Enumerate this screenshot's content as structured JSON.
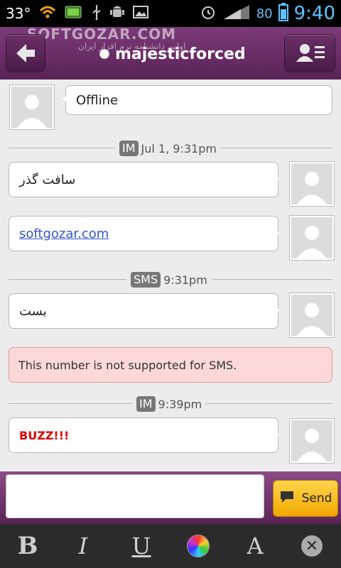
{
  "status_bar": {
    "temperature": "33°",
    "battery_percent": "80",
    "time": "9:40",
    "icons": [
      "wifi-icon",
      "battery-status-icon",
      "usb-icon",
      "android-debug-icon",
      "image-icon",
      "alarm-icon",
      "signal-icon",
      "battery-icon"
    ]
  },
  "header": {
    "watermark": "SOFTGOZAR.COM",
    "watermark_sub": "اولین دانشنامه نرم افزار ایران",
    "contact_name": "majesticforced",
    "presence": "offline",
    "back_icon": "back-arrow-icon",
    "contacts_icon": "contact-list-icon"
  },
  "conversation": {
    "status_bubble": {
      "text": "Offline"
    },
    "separators": [
      {
        "type": "IM",
        "time": "Jul 1, 9:31pm"
      },
      {
        "type": "SMS",
        "time": "9:31pm"
      },
      {
        "type": "IM",
        "time": "9:39pm"
      }
    ],
    "messages": [
      {
        "text": "سافت گذر",
        "kind": "text"
      },
      {
        "text": "softgozar.com",
        "kind": "link"
      },
      {
        "text": "بست",
        "kind": "text"
      },
      {
        "text": "BUZZ!!!",
        "kind": "buzz"
      }
    ],
    "error": {
      "text": "This number is not supported for SMS."
    }
  },
  "composer": {
    "input_value": "",
    "send_label": "Send",
    "send_icon": "chat-bubble-icon"
  },
  "toolbar": {
    "bold": "B",
    "italic": "I",
    "underline": "U",
    "font": "A",
    "color_icon": "color-wheel-icon",
    "close_icon": "close-icon"
  },
  "colors": {
    "header": "#6a2a66",
    "error_bg": "#fcd8d8",
    "buzz": "#dd0000",
    "send_button": "#f7c21e",
    "link": "#3355cc"
  }
}
